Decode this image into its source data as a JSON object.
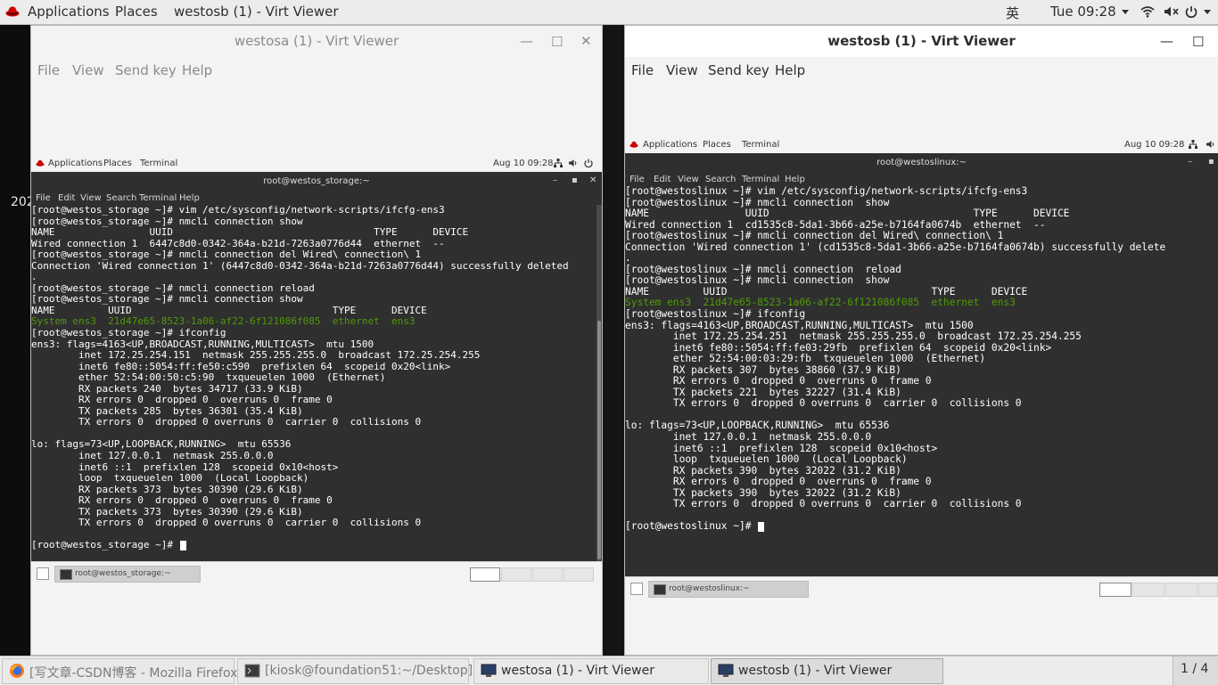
{
  "host_topbar": {
    "applications": "Applications",
    "places": "Places",
    "window_title": "westosb (1) - Virt Viewer",
    "input_method": "英",
    "clock": "Tue 09:28"
  },
  "desktop": {
    "fragment_text": "202"
  },
  "vv_left": {
    "title": "westosa (1) - Virt Viewer",
    "menu": [
      "File",
      "View",
      "Send key",
      "Help"
    ],
    "guest": {
      "topbar": {
        "applications": "Applications",
        "places": "Places",
        "terminal": "Terminal",
        "clock": "Aug 10  09:28"
      },
      "term_title": "root@westos_storage:~",
      "term_menu": [
        "File",
        "Edit",
        "View",
        "Search",
        "Terminal",
        "Help"
      ],
      "lines": [
        "[root@westos_storage ~]# vim /etc/sysconfig/network-scripts/ifcfg-ens3",
        "[root@westos_storage ~]# nmcli connection show",
        "NAME                UUID                                  TYPE      DEVICE",
        "Wired connection 1  6447c8d0-0342-364a-b21d-7263a0776d44  ethernet  --",
        "[root@westos_storage ~]# nmcli connection del Wired\\ connection\\ 1",
        "Connection 'Wired connection 1' (6447c8d0-0342-364a-b21d-7263a0776d44) successfully deleted",
        ".",
        "[root@westos_storage ~]# nmcli connection reload",
        "[root@westos_storage ~]# nmcli connection show",
        "NAME         UUID                                  TYPE      DEVICE",
        "System ens3  21d47e65-8523-1a06-af22-6f121086f085  ethernet  ens3",
        "[root@westos_storage ~]# ifconfig",
        "ens3: flags=4163<UP,BROADCAST,RUNNING,MULTICAST>  mtu 1500",
        "        inet 172.25.254.151  netmask 255.255.255.0  broadcast 172.25.254.255",
        "        inet6 fe80::5054:ff:fe50:c590  prefixlen 64  scopeid 0x20<link>",
        "        ether 52:54:00:50:c5:90  txqueuelen 1000  (Ethernet)",
        "        RX packets 240  bytes 34717 (33.9 KiB)",
        "        RX errors 0  dropped 0  overruns 0  frame 0",
        "        TX packets 285  bytes 36301 (35.4 KiB)",
        "        TX errors 0  dropped 0 overruns 0  carrier 0  collisions 0",
        "",
        "lo: flags=73<UP,LOOPBACK,RUNNING>  mtu 65536",
        "        inet 127.0.0.1  netmask 255.0.0.0",
        "        inet6 ::1  prefixlen 128  scopeid 0x10<host>",
        "        loop  txqueuelen 1000  (Local Loopback)",
        "        RX packets 373  bytes 30390 (29.6 KiB)",
        "        RX errors 0  dropped 0  overruns 0  frame 0",
        "        TX packets 373  bytes 30390 (29.6 KiB)",
        "        TX errors 0  dropped 0 overruns 0  carrier 0  collisions 0",
        "",
        "[root@westos_storage ~]# "
      ],
      "green_line_index": 10,
      "taskbar_item": "root@westos_storage:~"
    }
  },
  "vv_right": {
    "title": "westosb (1) - Virt Viewer",
    "menu": [
      "File",
      "View",
      "Send key",
      "Help"
    ],
    "guest": {
      "topbar": {
        "applications": "Applications",
        "places": "Places",
        "terminal": "Terminal",
        "clock": "Aug 10  09:28"
      },
      "term_title": "root@westoslinux:~",
      "term_menu": [
        "File",
        "Edit",
        "View",
        "Search",
        "Terminal",
        "Help"
      ],
      "lines": [
        "[root@westoslinux ~]# vim /etc/sysconfig/network-scripts/ifcfg-ens3",
        "[root@westoslinux ~]# nmcli connection  show",
        "NAME                UUID                                  TYPE      DEVICE",
        "Wired connection 1  cd1535c8-5da1-3b66-a25e-b7164fa0674b  ethernet  --",
        "[root@westoslinux ~]# nmcli connection del Wired\\ connection\\ 1",
        "Connection 'Wired connection 1' (cd1535c8-5da1-3b66-a25e-b7164fa0674b) successfully delete",
        ".",
        "[root@westoslinux ~]# nmcli connection  reload",
        "[root@westoslinux ~]# nmcli connection  show",
        "NAME         UUID                                  TYPE      DEVICE",
        "System ens3  21d47e65-8523-1a06-af22-6f121086f085  ethernet  ens3",
        "[root@westoslinux ~]# ifconfig",
        "ens3: flags=4163<UP,BROADCAST,RUNNING,MULTICAST>  mtu 1500",
        "        inet 172.25.254.251  netmask 255.255.255.0  broadcast 172.25.254.255",
        "        inet6 fe80::5054:ff:fe03:29fb  prefixlen 64  scopeid 0x20<link>",
        "        ether 52:54:00:03:29:fb  txqueuelen 1000  (Ethernet)",
        "        RX packets 307  bytes 38860 (37.9 KiB)",
        "        RX errors 0  dropped 0  overruns 0  frame 0",
        "        TX packets 221  bytes 32227 (31.4 KiB)",
        "        TX errors 0  dropped 0 overruns 0  carrier 0  collisions 0",
        "",
        "lo: flags=73<UP,LOOPBACK,RUNNING>  mtu 65536",
        "        inet 127.0.0.1  netmask 255.0.0.0",
        "        inet6 ::1  prefixlen 128  scopeid 0x10<host>",
        "        loop  txqueuelen 1000  (Local Loopback)",
        "        RX packets 390  bytes 32022 (31.2 KiB)",
        "        RX errors 0  dropped 0  overruns 0  frame 0",
        "        TX packets 390  bytes 32022 (31.2 KiB)",
        "        TX errors 0  dropped 0 overruns 0  carrier 0  collisions 0",
        "",
        "[root@westoslinux ~]# "
      ],
      "green_line_index": 10,
      "taskbar_item": "root@westoslinux:~"
    }
  },
  "bottom_taskbar": {
    "items": [
      "[写文章-CSDN博客 - Mozilla Firefox]",
      "[kiosk@foundation51:~/Desktop]",
      "westosa (1) - Virt Viewer",
      "westosb (1) - Virt Viewer"
    ],
    "pager": "1 / 4"
  },
  "colors": {
    "terminal_bg": "#2f2f2f",
    "terminal_green": "#4e9a06",
    "panel_bg": "#ececec"
  }
}
